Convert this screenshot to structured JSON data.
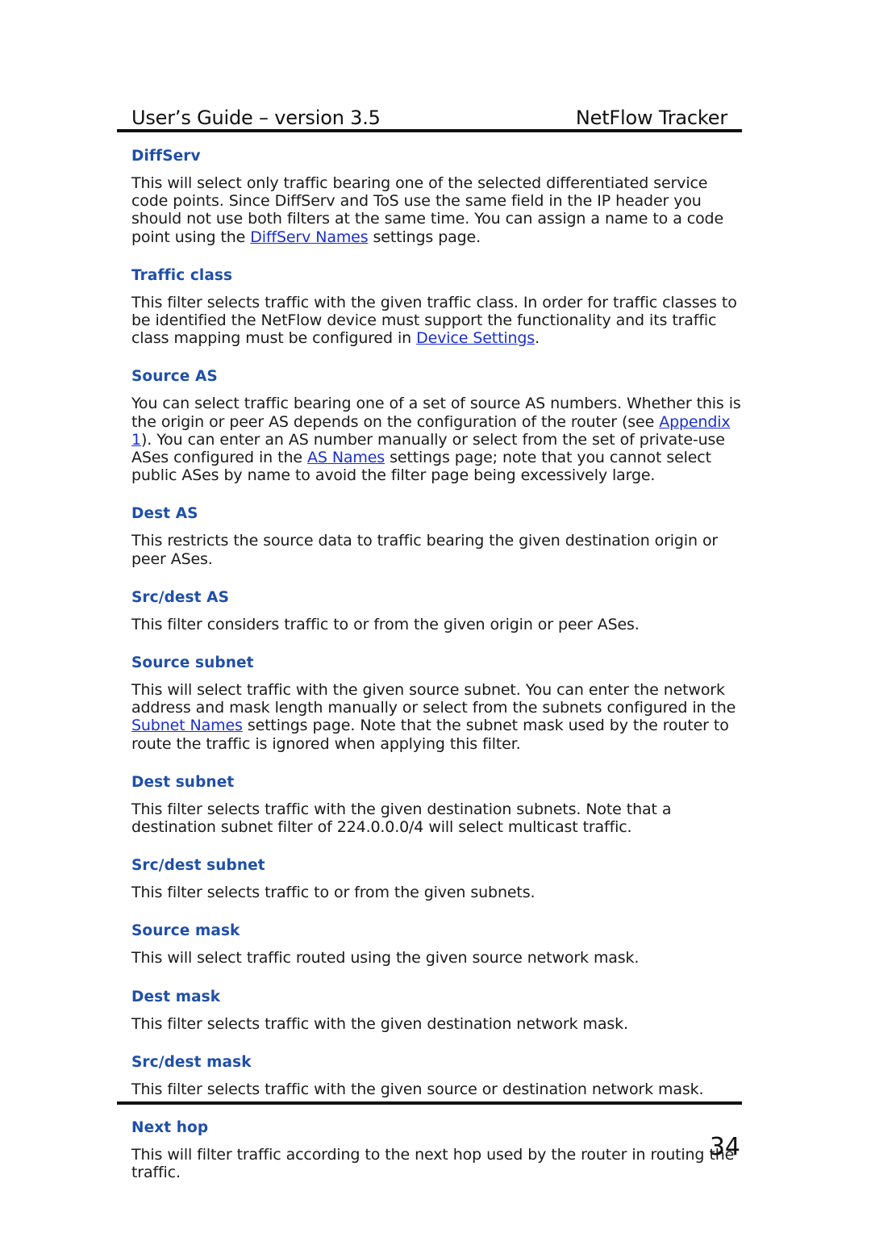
{
  "header": {
    "left_text": "User’s Guide – version 3.5",
    "right_text": "NetFlow Tracker"
  },
  "footer": {
    "page_number": "34"
  },
  "colors": {
    "heading": "#1f4fa8",
    "link": "#1c30c8",
    "body_text": "#1a1a1a",
    "rule": "#111111",
    "background": "#ffffff"
  },
  "sections": [
    {
      "title": "DiffServ",
      "body_parts": [
        {
          "type": "text",
          "text": "This will select only traffic bearing one of the selected differentiated service code points. Since DiffServ and ToS use the same field in the IP header you should not use both filters at the same time. You can assign a name to a code point using the "
        },
        {
          "type": "link",
          "text": "DiffServ Names"
        },
        {
          "type": "text",
          "text": " settings page."
        }
      ]
    },
    {
      "title": "Traffic class",
      "body_parts": [
        {
          "type": "text",
          "text": "This filter selects traffic with the given traffic class. In order for traffic classes to be identified the NetFlow device must support the functionality and its traffic class mapping must be configured in "
        },
        {
          "type": "link",
          "text": "Device Settings"
        },
        {
          "type": "text",
          "text": "."
        }
      ]
    },
    {
      "title": "Source AS",
      "body_parts": [
        {
          "type": "text",
          "text": "You can select traffic bearing one of a set of source AS numbers. Whether this is the origin or peer AS depends on the configuration of the router (see "
        },
        {
          "type": "link",
          "text": "Appendix 1"
        },
        {
          "type": "text",
          "text": "). You can enter an AS number manually or select from the set of private-use ASes configured in the "
        },
        {
          "type": "link",
          "text": "AS Names"
        },
        {
          "type": "text",
          "text": " settings page; note that you cannot select public ASes by name to avoid the filter page being excessively large."
        }
      ]
    },
    {
      "title": "Dest AS",
      "body_parts": [
        {
          "type": "text",
          "text": "This restricts the source data to traffic bearing the given destination origin or peer ASes."
        }
      ]
    },
    {
      "title": "Src/dest AS",
      "body_parts": [
        {
          "type": "text",
          "text": "This filter considers traffic to or from the given origin or peer ASes."
        }
      ]
    },
    {
      "title": "Source subnet",
      "body_parts": [
        {
          "type": "text",
          "text": "This will select traffic with the given source subnet. You can enter the network address and mask length manually or select from the subnets configured in the "
        },
        {
          "type": "link",
          "text": "Subnet Names"
        },
        {
          "type": "text",
          "text": " settings page. Note that the subnet mask used by the router to route the traffic is ignored when applying this filter."
        }
      ]
    },
    {
      "title": "Dest subnet",
      "body_parts": [
        {
          "type": "text",
          "text": "This filter selects traffic with the given destination subnets. Note that a destination subnet filter of 224.0.0.0/4 will select multicast traffic."
        }
      ]
    },
    {
      "title": "Src/dest subnet",
      "body_parts": [
        {
          "type": "text",
          "text": "This filter selects traffic to or from the given subnets."
        }
      ]
    },
    {
      "title": "Source mask",
      "body_parts": [
        {
          "type": "text",
          "text": "This will select traffic routed using the given source network mask."
        }
      ]
    },
    {
      "title": "Dest mask",
      "body_parts": [
        {
          "type": "text",
          "text": "This filter selects traffic with the given destination network mask."
        }
      ]
    },
    {
      "title": "Src/dest mask",
      "body_parts": [
        {
          "type": "text",
          "text": "This filter selects traffic with the given source or destination network mask."
        }
      ]
    },
    {
      "title": "Next hop",
      "body_parts": [
        {
          "type": "text",
          "text": "This will filter traffic according to the next hop used by the router in routing the traffic."
        }
      ]
    }
  ]
}
